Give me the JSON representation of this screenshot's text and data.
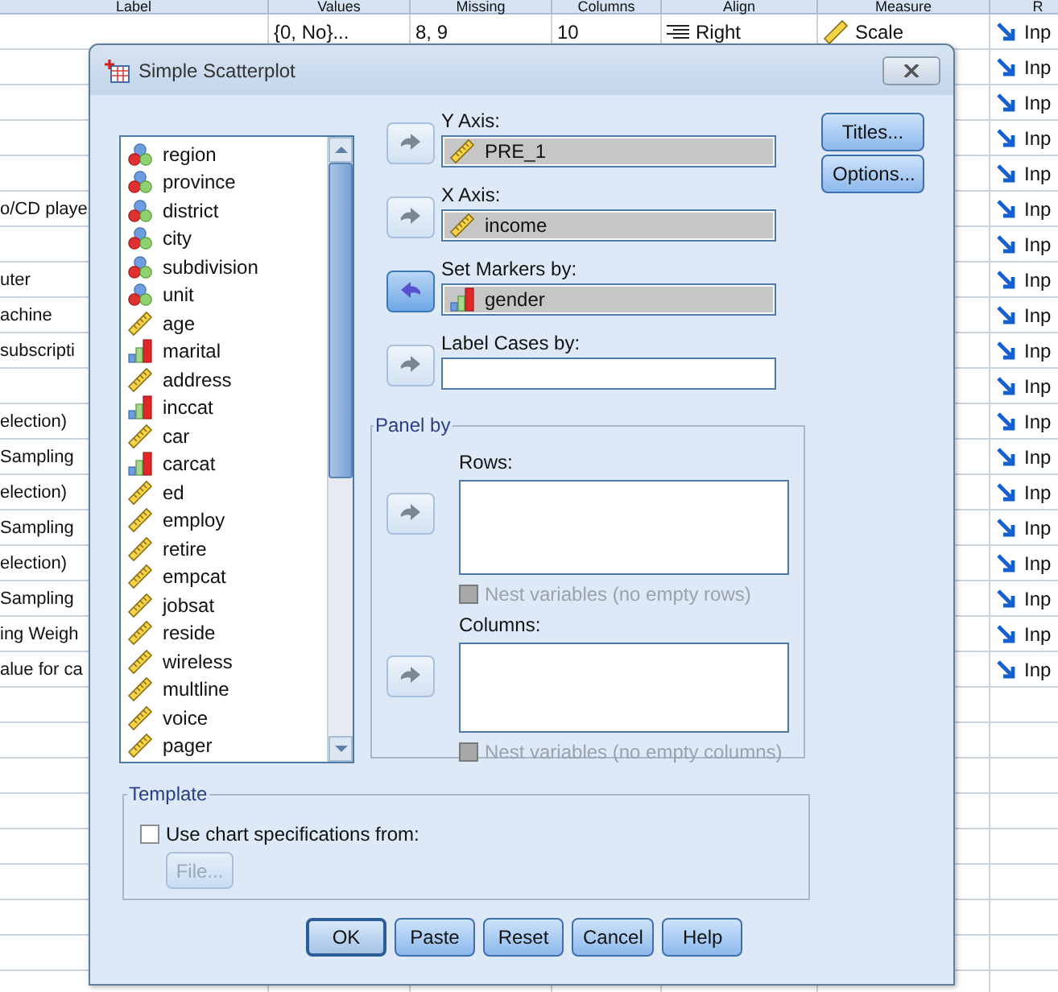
{
  "grid": {
    "columns": [
      "Label",
      "Values",
      "Missing",
      "Columns",
      "Align",
      "Measure",
      "R"
    ],
    "rows": [
      {
        "values": "{0, No}...",
        "missing": "8, 9",
        "columns": "10",
        "align": "Right",
        "measure": "Scale",
        "role": "Inp"
      },
      {
        "role": "Inp"
      },
      {
        "role": "Inp"
      },
      {
        "role": "Inp"
      },
      {
        "role": "Inp"
      },
      {
        "label": "o/CD playe",
        "role": "Inp"
      },
      {
        "role": "Inp"
      },
      {
        "label": "uter",
        "role": "Inp"
      },
      {
        "label": "achine",
        "role": "Inp"
      },
      {
        "label": "subscripti",
        "role": "Inp"
      },
      {
        "role": "Inp"
      },
      {
        "label": "election)",
        "role": "Inp"
      },
      {
        "label": "Sampling",
        "role": "Inp"
      },
      {
        "label": "election)",
        "role": "Inp"
      },
      {
        "label": "Sampling",
        "role": "Inp"
      },
      {
        "label": "election)",
        "role": "Inp"
      },
      {
        "label": "Sampling",
        "role": "Inp"
      },
      {
        "label": "ing Weigh",
        "role": "Inp"
      },
      {
        "label": "alue for ca",
        "role": "Inp"
      }
    ]
  },
  "dialog": {
    "title": "Simple Scatterplot",
    "variables": [
      {
        "name": "region",
        "kind": "nominal"
      },
      {
        "name": "province",
        "kind": "nominal"
      },
      {
        "name": "district",
        "kind": "nominal"
      },
      {
        "name": "city",
        "kind": "nominal"
      },
      {
        "name": "subdivision",
        "kind": "nominal"
      },
      {
        "name": "unit",
        "kind": "nominal"
      },
      {
        "name": "age",
        "kind": "scale"
      },
      {
        "name": "marital",
        "kind": "ordinal"
      },
      {
        "name": "address",
        "kind": "scale"
      },
      {
        "name": "inccat",
        "kind": "ordinal"
      },
      {
        "name": "car",
        "kind": "scale"
      },
      {
        "name": "carcat",
        "kind": "ordinal"
      },
      {
        "name": "ed",
        "kind": "scale"
      },
      {
        "name": "employ",
        "kind": "scale"
      },
      {
        "name": "retire",
        "kind": "scale"
      },
      {
        "name": "empcat",
        "kind": "scale"
      },
      {
        "name": "jobsat",
        "kind": "scale"
      },
      {
        "name": "reside",
        "kind": "scale"
      },
      {
        "name": "wireless",
        "kind": "scale"
      },
      {
        "name": "multline",
        "kind": "scale"
      },
      {
        "name": "voice",
        "kind": "scale"
      },
      {
        "name": "pager",
        "kind": "scale"
      }
    ],
    "targets": [
      {
        "label": "Y Axis:",
        "kind": "right",
        "variable": {
          "name": "PRE_1",
          "kind": "scale"
        }
      },
      {
        "label": "X Axis:",
        "kind": "right",
        "variable": {
          "name": "income",
          "kind": "scale"
        }
      },
      {
        "label": "Set Markers by:",
        "kind": "left",
        "variable": {
          "name": "gender",
          "kind": "ordinal"
        }
      },
      {
        "label": "Label Cases by:",
        "kind": "right"
      }
    ],
    "panel": {
      "title": "Panel by",
      "lists": [
        {
          "label": "Rows:",
          "kind": "right",
          "nest": {
            "label": "Nest variables (no empty rows)",
            "checked": false,
            "disabled": true
          }
        },
        {
          "label": "Columns:",
          "kind": "right",
          "nest": {
            "label": "Nest variables (no empty columns)",
            "checked": false,
            "disabled": true
          }
        }
      ]
    },
    "side_buttons": [
      "Titles...",
      "Options..."
    ],
    "template": {
      "title": "Template",
      "checkbox": {
        "label": "Use chart specifications from:",
        "checked": false,
        "disabled": false
      },
      "file_button": {
        "label": "File...",
        "disabled": true
      }
    },
    "buttons": [
      {
        "label": "OK",
        "default": true
      },
      {
        "label": "Paste",
        "default": false
      },
      {
        "label": "Reset",
        "default": false
      },
      {
        "label": "Cancel",
        "default": false
      },
      {
        "label": "Help",
        "default": false
      }
    ]
  }
}
